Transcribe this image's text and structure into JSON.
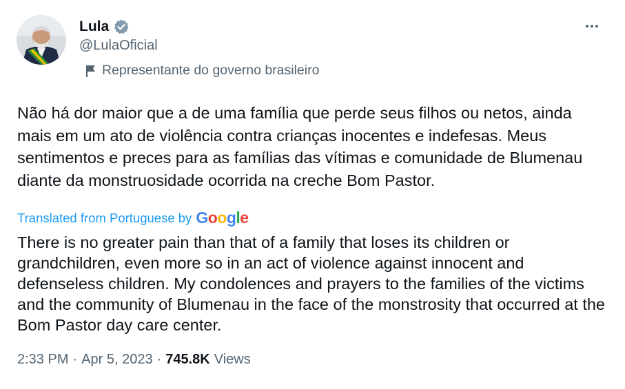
{
  "author": {
    "name": "Lula",
    "handle": "@LulaOficial",
    "affiliation": "Representante do governo brasileiro"
  },
  "icons": {
    "verified": "verified-badge-icon",
    "more": "more-options-icon",
    "affiliation": "government-flag-icon"
  },
  "tweet": {
    "original_text": "Não há dor maior que a de uma família que perde seus filhos ou netos, ainda mais em um ato de violência contra crianças inocentes e indefesas. Meus sentimentos e preces para as famílias das vítimas e comunidade de Blumenau diante da monstruosidade ocorrida na creche Bom Pastor.",
    "translated_label": "Translated from Portuguese by",
    "translator": {
      "letters": [
        "G",
        "o",
        "o",
        "g",
        "l",
        "e"
      ]
    },
    "translated_text": "There is no greater pain than that of a family that loses its children or grandchildren, even more so in an act of violence against innocent and defenseless children. My condolences and prayers to the families of the victims and the community of Blumenau in the face of the monstrosity that occurred at the Bom Pastor day care center."
  },
  "meta": {
    "time": "2:33 PM",
    "separator": "·",
    "date": "Apr 5, 2023",
    "views_count": "745.8K",
    "views_label": "Views"
  },
  "colors": {
    "text": "#0f1419",
    "secondary": "#536471",
    "link": "#1d9bf0",
    "verified_gold": "#829aab"
  }
}
